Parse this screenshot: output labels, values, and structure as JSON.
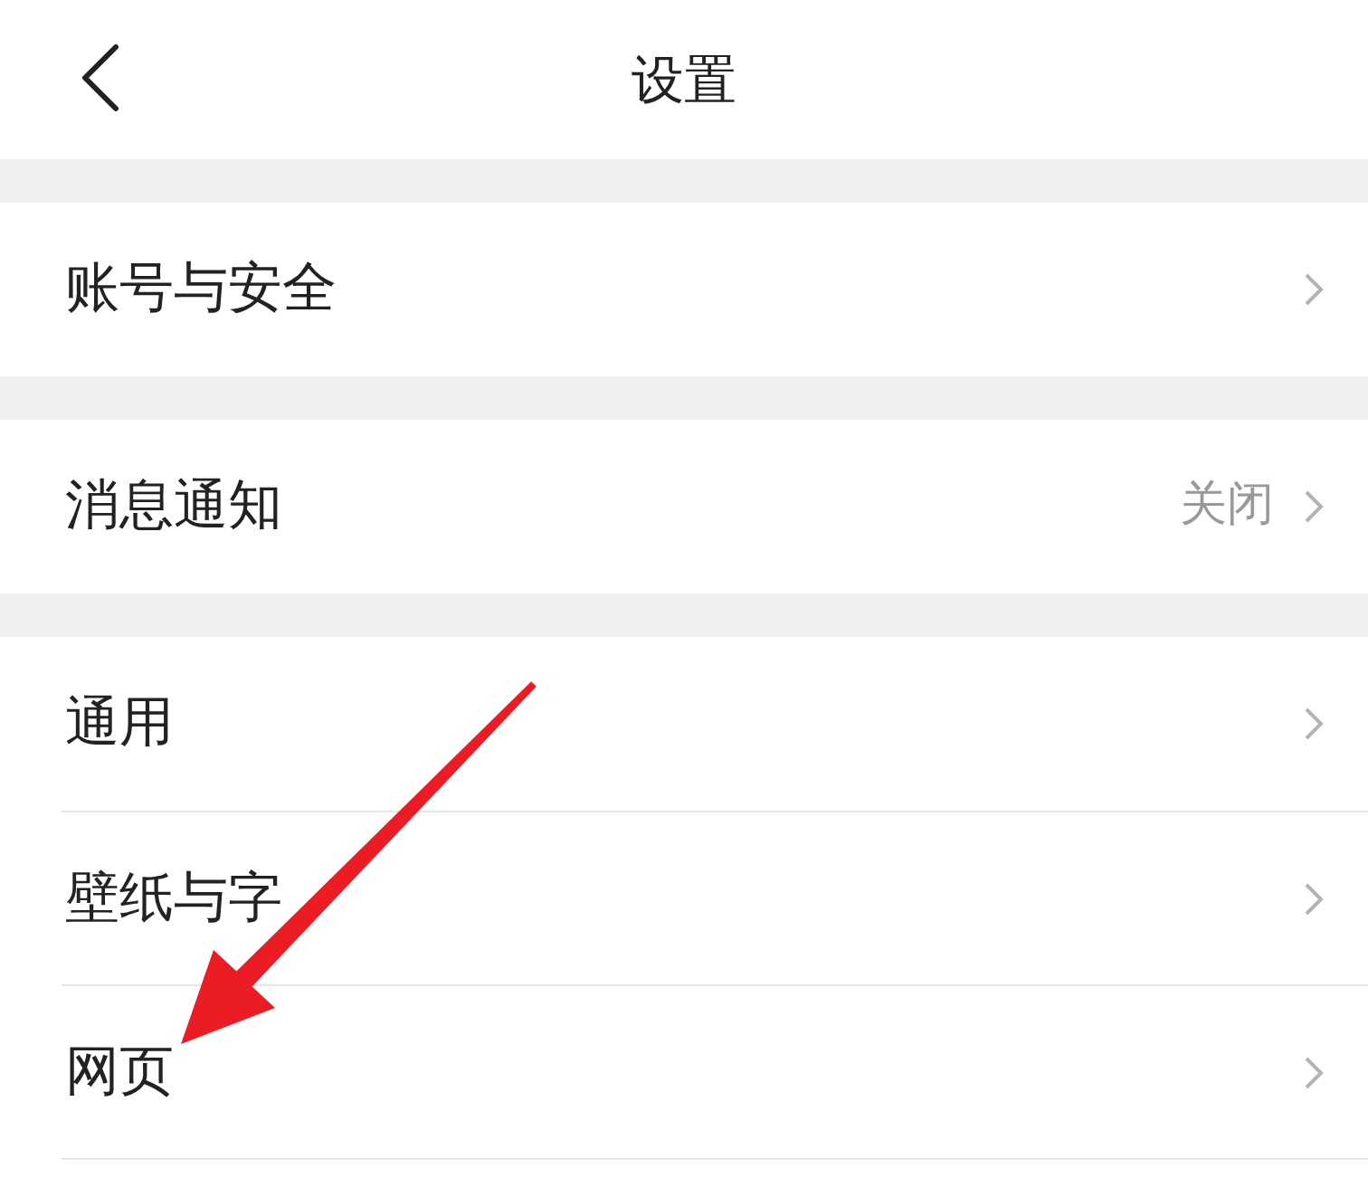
{
  "header": {
    "title": "设置"
  },
  "groups": [
    {
      "items": [
        {
          "label": "账号与安全"
        }
      ]
    },
    {
      "items": [
        {
          "label": "消息通知",
          "value": "关闭"
        }
      ]
    },
    {
      "items": [
        {
          "label": "通用"
        },
        {
          "label": "壁纸与字"
        },
        {
          "label": "网页"
        }
      ]
    }
  ]
}
